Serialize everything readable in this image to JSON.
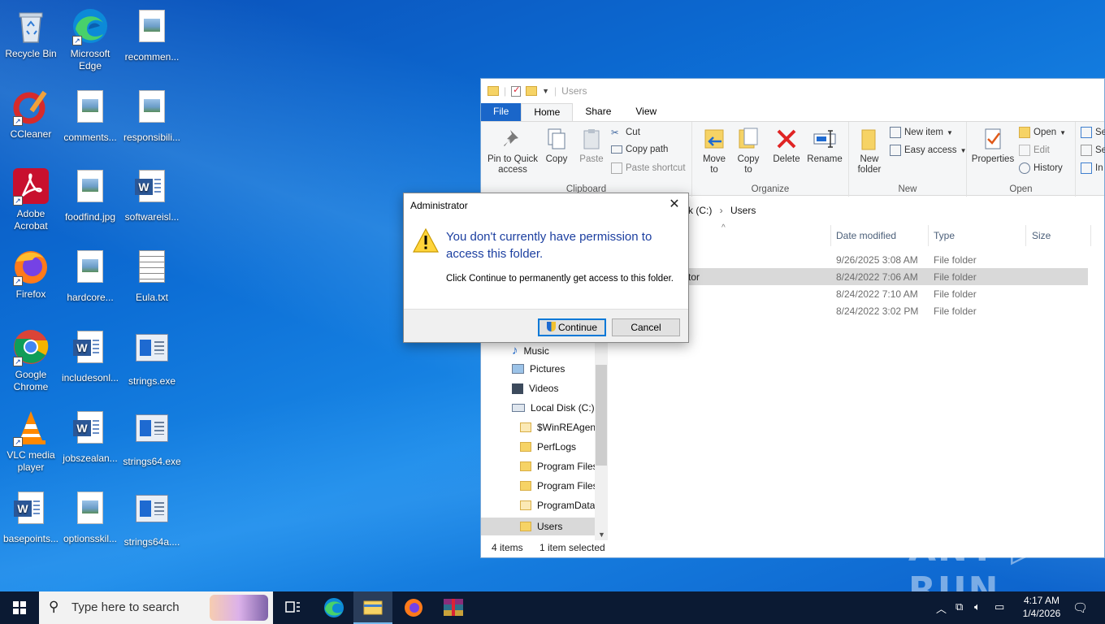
{
  "desktop": {
    "icons": [
      {
        "label": "Recycle Bin"
      },
      {
        "label": "Microsoft Edge"
      },
      {
        "label": "recommen..."
      },
      {
        "label": "CCleaner"
      },
      {
        "label": "comments..."
      },
      {
        "label": "responsibili..."
      },
      {
        "label": "Adobe Acrobat"
      },
      {
        "label": "foodfind.jpg"
      },
      {
        "label": "softwareisl..."
      },
      {
        "label": "Firefox"
      },
      {
        "label": "hardcore..."
      },
      {
        "label": "Eula.txt"
      },
      {
        "label": "Google Chrome"
      },
      {
        "label": "includesonl..."
      },
      {
        "label": "strings.exe"
      },
      {
        "label": "VLC media player"
      },
      {
        "label": "jobszealan..."
      },
      {
        "label": "strings64.exe"
      },
      {
        "label": "basepoints..."
      },
      {
        "label": "optionsskil..."
      },
      {
        "label": "strings64a...."
      }
    ]
  },
  "explorer": {
    "title": "Users",
    "tabs": [
      "File",
      "Home",
      "Share",
      "View"
    ],
    "ribbon": {
      "pin": "Pin to Quick access",
      "copy": "Copy",
      "paste": "Paste",
      "cut": "Cut",
      "copy_path": "Copy path",
      "paste_shortcut": "Paste shortcut",
      "clipboard": "Clipboard",
      "move_to": "Move to",
      "copy_to": "Copy to",
      "delete": "Delete",
      "rename": "Rename",
      "organize": "Organize",
      "new_folder": "New folder",
      "new_item": "New item",
      "easy_access": "Easy access",
      "new": "New",
      "properties": "Properties",
      "open_btn": "Open",
      "edit": "Edit",
      "history": "History",
      "open": "Open",
      "select_1": "Se",
      "select_2": "Se",
      "select_3": "In"
    },
    "address": {
      "drive": "k (C:)",
      "sep": "›",
      "folder": "Users"
    },
    "columns": {
      "date": "Date modified",
      "type": "Type",
      "size": "Size"
    },
    "rows": [
      {
        "name": "",
        "date": "9/26/2025 3:08 AM",
        "type": "File folder"
      },
      {
        "name": "tor",
        "date": "8/24/2022 7:06 AM",
        "type": "File folder"
      },
      {
        "name": "",
        "date": "8/24/2022 7:10 AM",
        "type": "File folder"
      },
      {
        "name": "",
        "date": "8/24/2022 3:02 PM",
        "type": "File folder"
      }
    ],
    "nav": [
      {
        "label": "Music"
      },
      {
        "label": "Pictures"
      },
      {
        "label": "Videos"
      },
      {
        "label": "Local Disk (C:)"
      },
      {
        "label": "$WinREAgent"
      },
      {
        "label": "PerfLogs"
      },
      {
        "label": "Program Files"
      },
      {
        "label": "Program Files"
      },
      {
        "label": "ProgramData"
      },
      {
        "label": "Users"
      }
    ],
    "status": {
      "items": "4 items",
      "selected": "1 item selected"
    }
  },
  "dialog": {
    "title": "Administrator",
    "close": "✕",
    "main": "You don't currently have permission to access this folder.",
    "sub": "Click Continue to permanently get access to this folder.",
    "continue": "Continue",
    "cancel": "Cancel"
  },
  "taskbar": {
    "search_placeholder": "Type here to search",
    "time": "4:17 AM",
    "date": "1/4/2026"
  },
  "watermark": "ANY ▷ RUN",
  "colors": {
    "accent": "#0078d7",
    "taskbar": "#0b1a33",
    "dialog_text": "#1c3fa0"
  }
}
